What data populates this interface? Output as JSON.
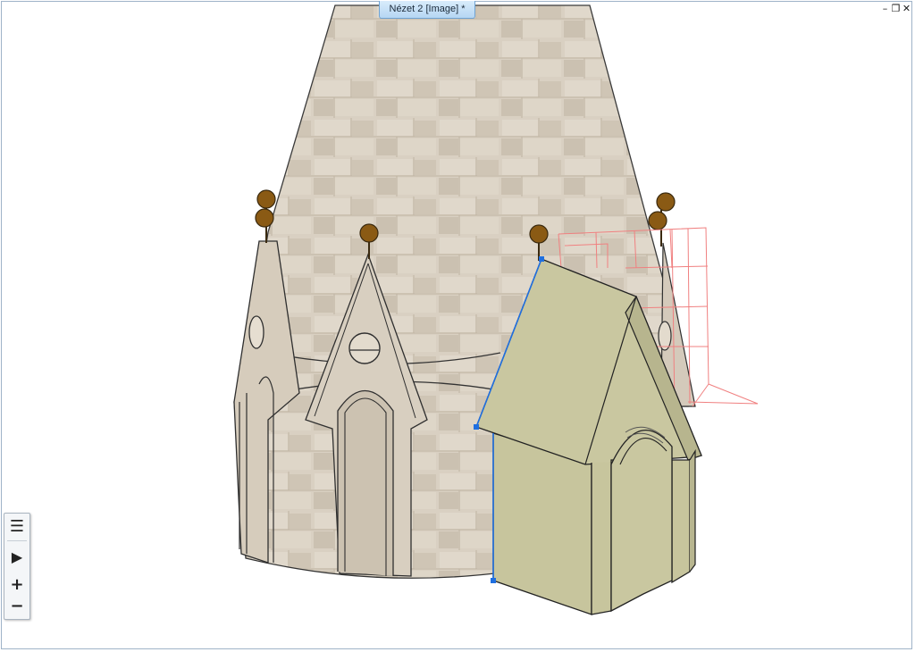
{
  "window": {
    "title": "Nézet 2 [Image] *",
    "controls": {
      "minimize": "–",
      "restore": "❐",
      "close": "✕"
    }
  },
  "nav_toolbar": {
    "layers_icon": "☰",
    "play_icon": "▶",
    "zoom_in": "+",
    "zoom_out": "−"
  },
  "colors": {
    "stone": "#d8cfc1",
    "stone_dark": "#c9bfae",
    "panel": "#c7c59e",
    "selection": "#1f6fe0",
    "bounding_box": "#f08080",
    "finial": "#8a5a14"
  }
}
